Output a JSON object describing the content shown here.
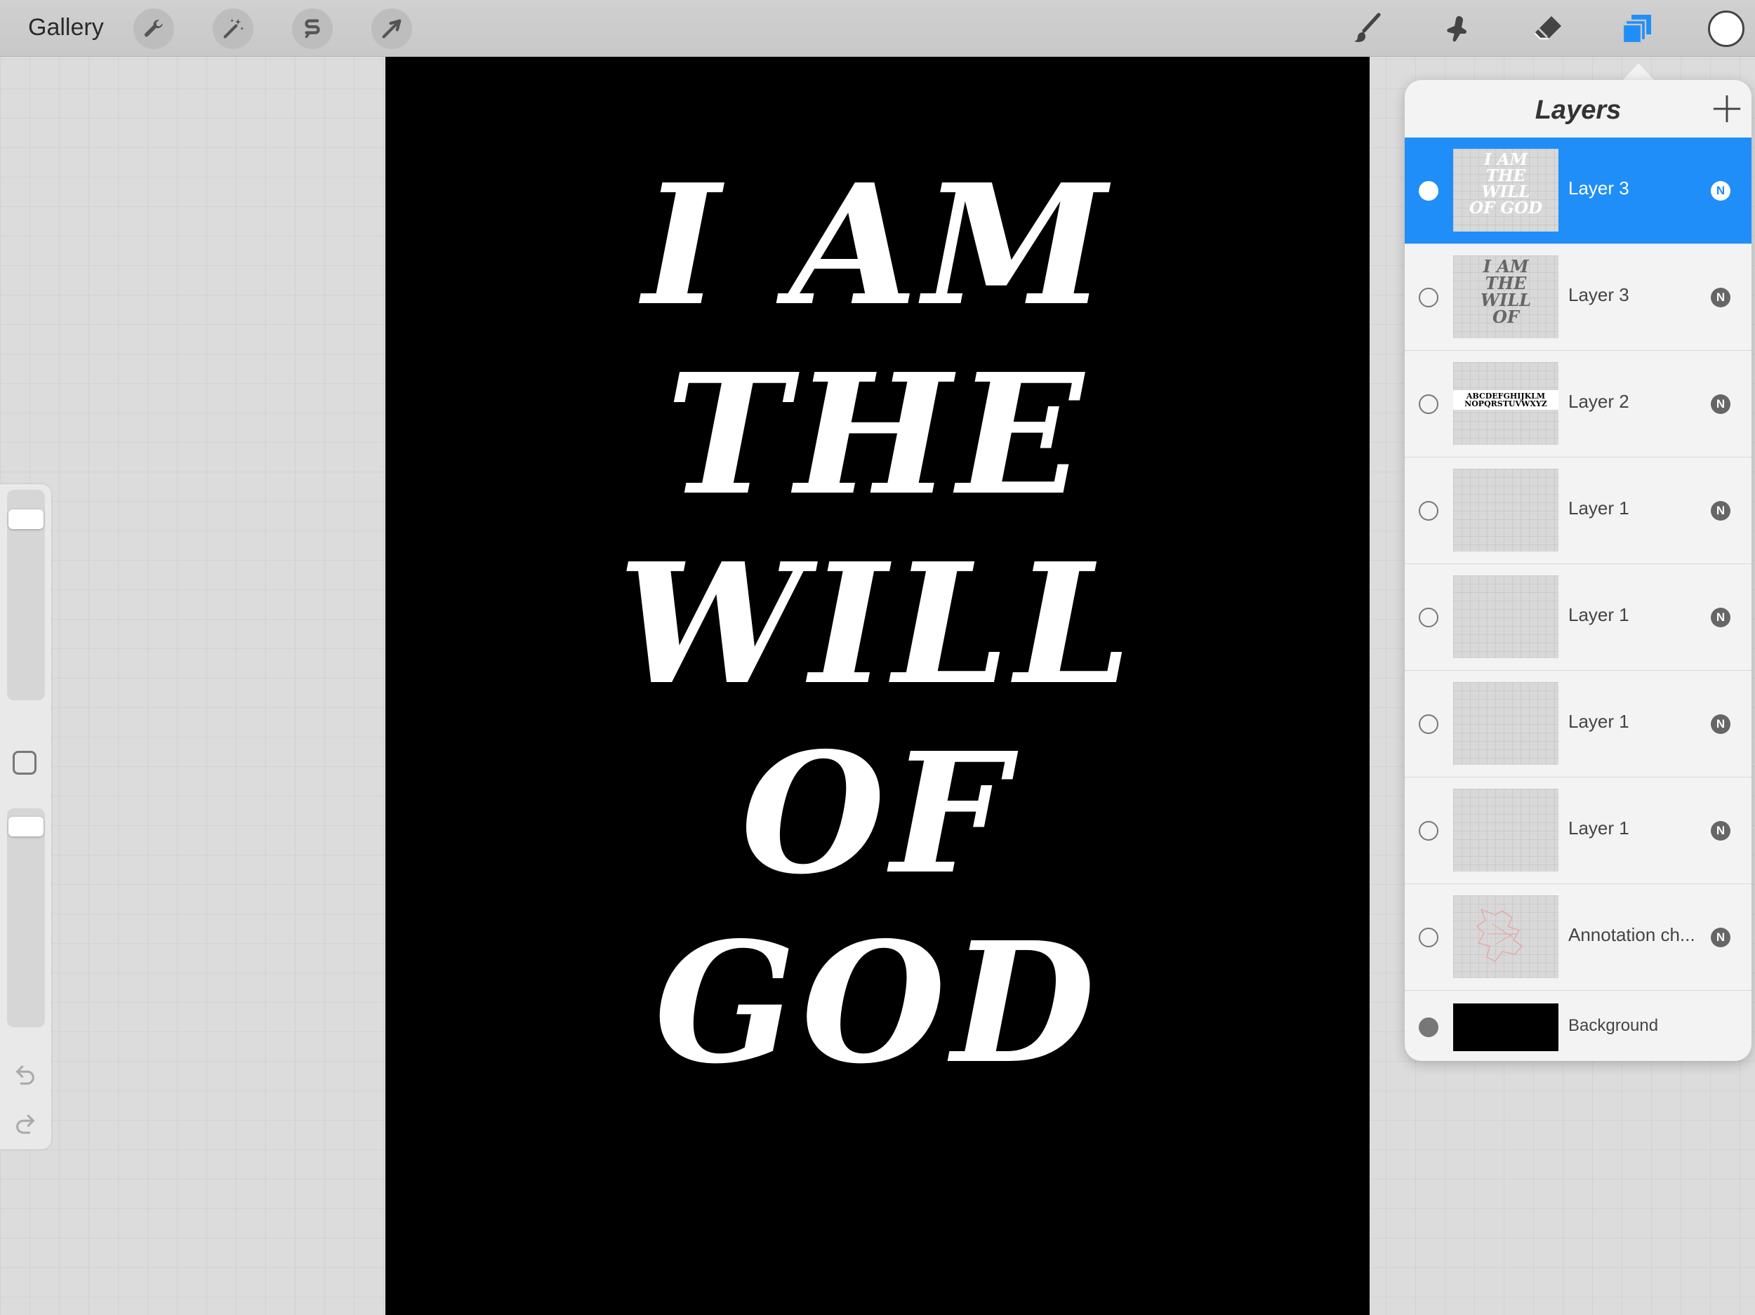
{
  "topbar": {
    "gallery_label": "Gallery",
    "left_tools": [
      "wrench-icon",
      "magic-wand-icon",
      "selection-s-icon",
      "transform-arrow-icon"
    ],
    "right_tools": [
      "brush-icon",
      "smudge-icon",
      "eraser-icon",
      "layers-icon"
    ],
    "color_swatch": "#ffffff",
    "active_tool_color": "#1f8ef8"
  },
  "canvas": {
    "background": "#000000",
    "lines": [
      "I AM",
      "THE",
      "WILL",
      "OF",
      "GOD"
    ]
  },
  "sidebar": {
    "brush_size_slider": "size-slider",
    "opacity_slider": "opacity-slider"
  },
  "layers": {
    "title": "Layers",
    "items": [
      {
        "name": "Layer 3",
        "blend": "N",
        "selected": true,
        "thumb_text": "I AM THE WILL OF GOD"
      },
      {
        "name": "Layer 3",
        "blend": "N",
        "selected": false,
        "thumb_text": "I AM THE WILL OF"
      },
      {
        "name": "Layer 2",
        "blend": "N",
        "selected": false,
        "thumb_text": "ABCDEFGHIJKLM NOPQRSTUVWXYZ"
      },
      {
        "name": "Layer 1",
        "blend": "N",
        "selected": false
      },
      {
        "name": "Layer 1",
        "blend": "N",
        "selected": false
      },
      {
        "name": "Layer 1",
        "blend": "N",
        "selected": false
      },
      {
        "name": "Layer 1",
        "blend": "N",
        "selected": false
      },
      {
        "name": "Annotation ch...",
        "blend": "N",
        "selected": false
      },
      {
        "name": "Background",
        "selected": false
      }
    ]
  }
}
